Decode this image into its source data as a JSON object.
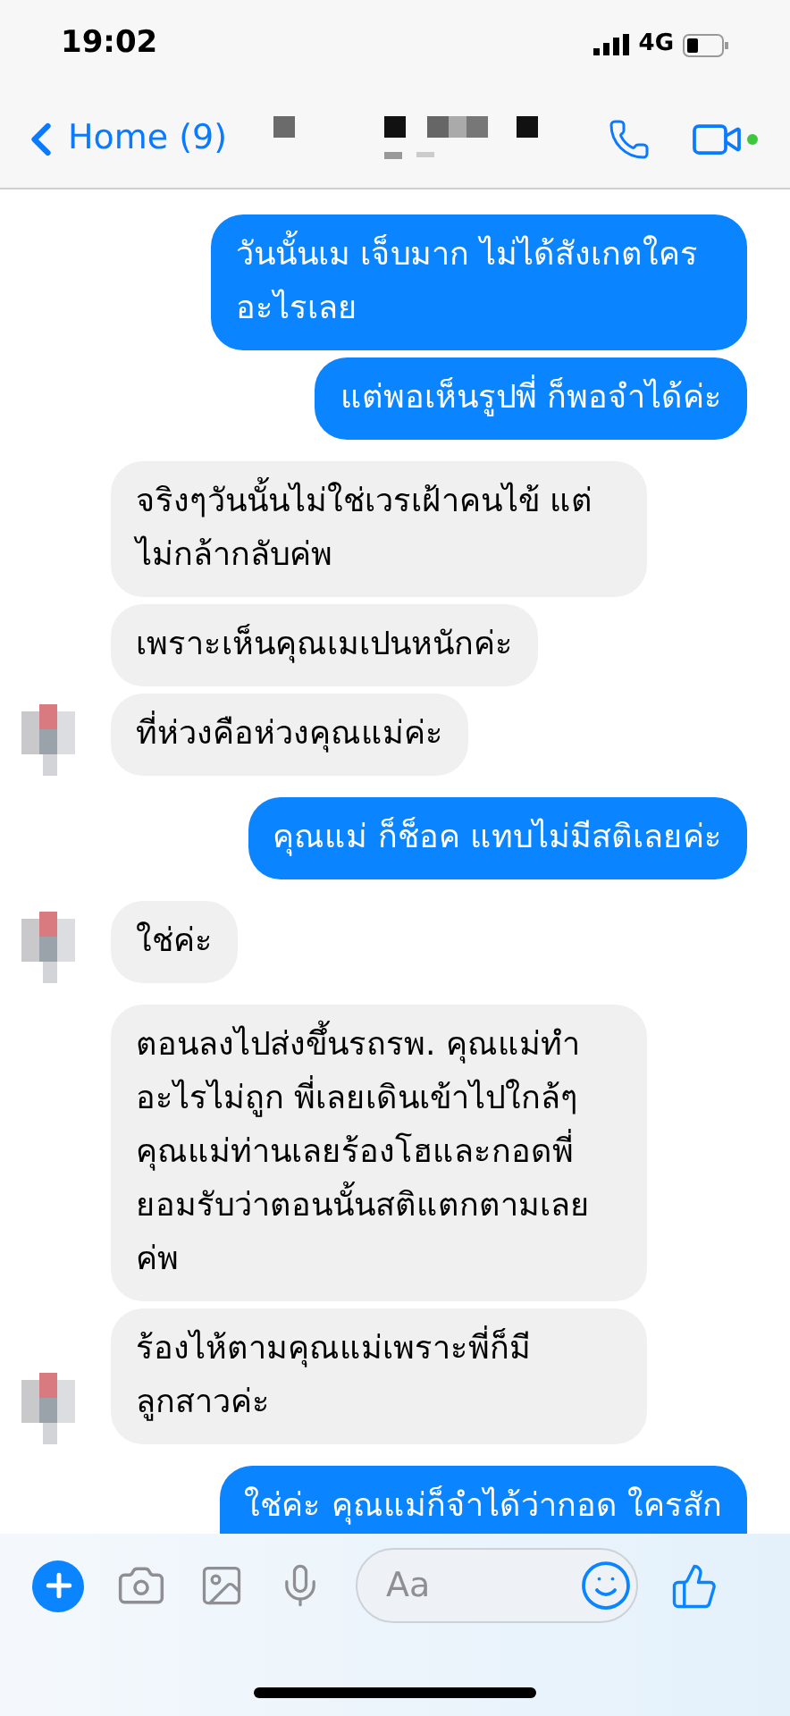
{
  "status_bar": {
    "time": "19:02",
    "network": "4G"
  },
  "header": {
    "back_label": "Home (9)",
    "video_online": true
  },
  "messages": [
    {
      "kind": "sent",
      "text": "วันนั้นเม เจ็บมาก ไม่ได้สังเกตใคร อะไรเลย",
      "avatar": false
    },
    {
      "kind": "sent",
      "text": "แต่พอเห็นรูปพี่ ก็พอจำได้ค่ะ",
      "avatar": false
    },
    {
      "kind": "received",
      "text": "จริงๆวันนั้นไม่ใช่เวรเฝ้าคนไข้ แต่ ไม่กล้ากลับค่พ",
      "avatar": false
    },
    {
      "kind": "received",
      "text": "เพราะเห็นคุณเมเปนหนักค่ะ",
      "avatar": false
    },
    {
      "kind": "received",
      "text": "ที่ห่วงคือห่วงคุณแม่ค่ะ",
      "avatar": true
    },
    {
      "kind": "sent",
      "text": "คุณแม่ ก็ช็อค แทบไม่มีสติเลยค่ะ",
      "avatar": false
    },
    {
      "kind": "received",
      "text": "ใช่ค่ะ",
      "avatar": true
    },
    {
      "kind": "received",
      "text": "ตอนลงไปส่งขึ้นรถรพ. คุณแม่ทำ อะไรไม่ถูก พี่เลยเดินเข้าไปใกล้ๆ คุณแม่ท่านเลยร้องโฮและกอดพี่ ยอมรับว่าตอนนั้นสติแตกตามเลย ค่พ",
      "avatar": false
    },
    {
      "kind": "received",
      "text": "ร้องไห้ตามคุณแม่เพราะพี่ก็มี ลูกสาวค่ะ",
      "avatar": true
    },
    {
      "kind": "sent",
      "text": "ใช่ค่ะ คุณแม่ก็จำได้ว่ากอด ใครสัก",
      "avatar": false,
      "clipped": true
    }
  ],
  "composer": {
    "placeholder": "Aa"
  }
}
